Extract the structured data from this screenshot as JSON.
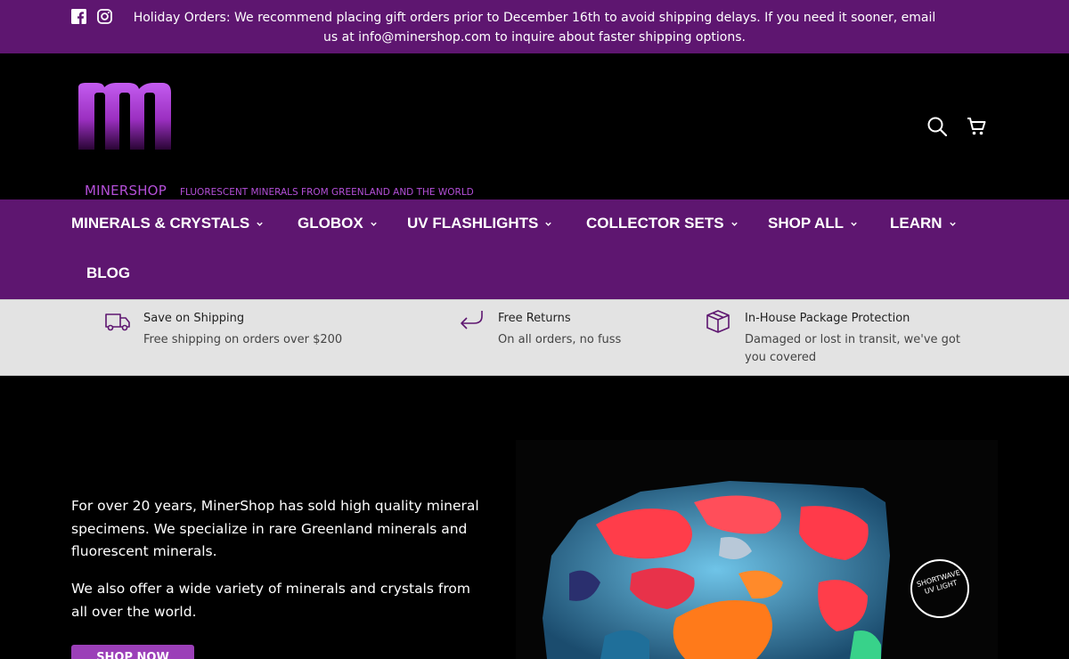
{
  "announcement": {
    "text": "Holiday Orders: We recommend placing gift orders prior to December 16th to avoid shipping delays. If you need it sooner, email us at info@minershop.com to inquire about faster shipping options.",
    "icons": [
      "facebook-icon",
      "instagram-icon"
    ]
  },
  "header": {
    "brand": "MINERSHOP",
    "tagline": "FLUORESCENT MINERALS FROM GREENLAND AND THE WORLD",
    "icons": [
      "search-icon",
      "cart-icon"
    ]
  },
  "nav": {
    "items": [
      {
        "label": "MINERALS & CRYSTALS"
      },
      {
        "label": "GLOBOX"
      },
      {
        "label": "UV FLASHLIGHTS"
      },
      {
        "label": "COLLECTOR SETS"
      },
      {
        "label": "SHOP ALL"
      },
      {
        "label": "LEARN"
      },
      {
        "label": "BLOG"
      }
    ]
  },
  "features": [
    {
      "icon": "truck-icon",
      "title": "Save on Shipping",
      "desc": "Free shipping on orders over $200"
    },
    {
      "icon": "return-arrow-icon",
      "title": "Free Returns",
      "desc": "On all orders, no fuss"
    },
    {
      "icon": "package-box-icon",
      "title": "In-House Package Protection",
      "desc": "Damaged or lost in transit, we've got you covered"
    }
  ],
  "hero": {
    "paragraph1": "For over 20 years, MinerShop has sold high quality mineral specimens. We specialize in rare Greenland minerals and fluorescent minerals.",
    "paragraph2": "We also offer a wide variety of minerals and crystals from all over the world.",
    "button_label": "SHOP NOW",
    "badge": "SHORTWAVE UV LIGHT"
  },
  "colors": {
    "brand_purple": "#5e1670",
    "logo_magenta": "#b44fd8",
    "button_purple": "#9b3fb8",
    "feature_bar": "#e3e3e3"
  }
}
